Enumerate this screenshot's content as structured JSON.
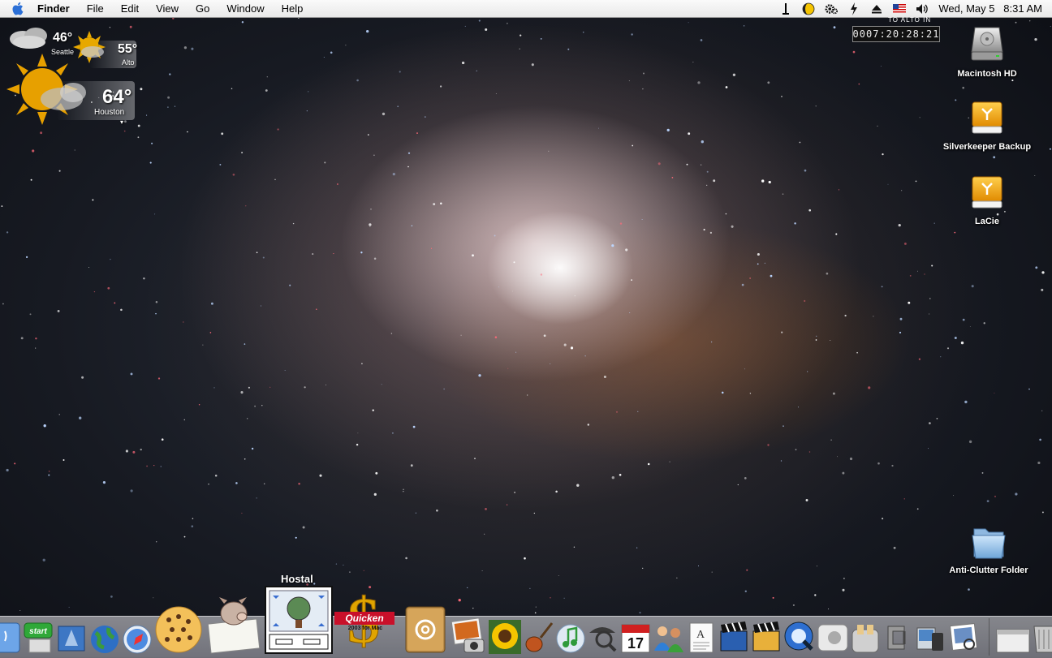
{
  "menubar": {
    "apple_icon": "apple-icon",
    "items": [
      {
        "label": "Finder",
        "bold": true
      },
      {
        "label": "File"
      },
      {
        "label": "Edit"
      },
      {
        "label": "View"
      },
      {
        "label": "Go"
      },
      {
        "label": "Window"
      },
      {
        "label": "Help"
      }
    ],
    "extras": [
      "wifi-icon",
      "lunar-icon",
      "gear-icon",
      "power-icon",
      "eject-icon",
      "us-flag-icon",
      "volume-icon"
    ],
    "clock": "Wed, May 5   8:31 AM"
  },
  "weather": {
    "seattle": {
      "temp": "46°",
      "city": "Seattle"
    },
    "alto": {
      "temp": "55°",
      "city": "Alto"
    },
    "houston": {
      "temp": "64°",
      "city": "Houston"
    }
  },
  "countdown": {
    "label": "TO ALTO IN",
    "value": "0007:20:28:21"
  },
  "desktop_icons": [
    {
      "label": "Macintosh HD",
      "icon": "hard-drive-icon"
    },
    {
      "label": "Silverkeeper Backup",
      "icon": "firewire-drive-icon"
    },
    {
      "label": "LaCie",
      "icon": "firewire-drive-icon"
    },
    {
      "label": "Anti-Clutter Folder",
      "icon": "folder-icon"
    }
  ],
  "dock": {
    "tooltip": "Hostal",
    "quicken_label": "Quicken",
    "quicken_sub": "2003 for Mac",
    "start_label": "start",
    "ical_day": "17",
    "items": [
      "finder",
      "start",
      "mail-bird",
      "internet-connect",
      "safari",
      "cookie",
      "pig",
      "hostal",
      "quicken",
      "address-book",
      "iphoto",
      "sunflower",
      "garageband",
      "itunes",
      "sherlock",
      "ical",
      "ichat-buddies",
      "text-edit",
      "imovie",
      "idvd",
      "quicktime",
      "apple-works",
      "toast",
      "system-prefs-clamp",
      "ipod-sync",
      "preview"
    ],
    "accent": "#e5a800"
  }
}
